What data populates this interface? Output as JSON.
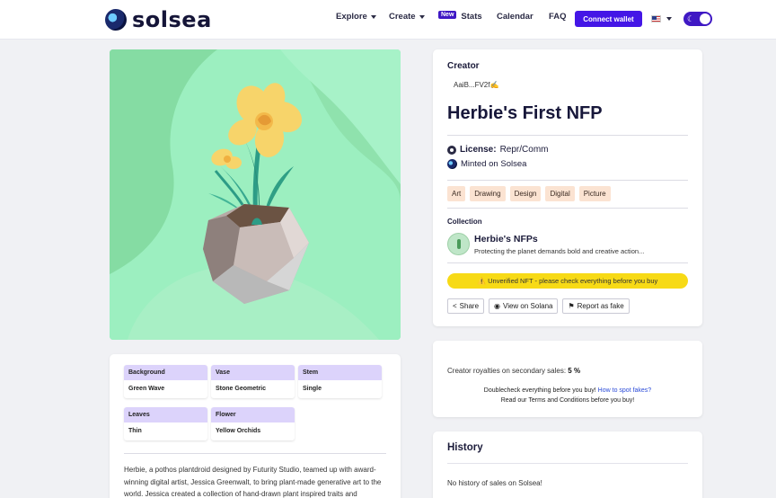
{
  "header": {
    "brand": "solsea",
    "nav": [
      {
        "label": "Explore",
        "dropdown": true
      },
      {
        "label": "Create",
        "dropdown": true
      },
      {
        "label": "Stats",
        "badge": "New"
      },
      {
        "label": "Calendar"
      },
      {
        "label": "FAQ"
      }
    ],
    "connect_label": "Connect wallet",
    "language": "us-flag-icon",
    "theme_toggle": "dark-mode"
  },
  "colors": {
    "accent": "#4416e6",
    "badge": "#3f18c4",
    "warning": "#f7da16",
    "tag_bg": "#fbe3d2",
    "attr_header": "#dcd3fb",
    "art_bg": "#7fdfa0"
  },
  "creator": {
    "label": "Creator",
    "address": "AaiB...FV2f✍"
  },
  "nft": {
    "title": "Herbie's First NFP",
    "license_label": "License:",
    "license_value": "Repr/Comm",
    "minted": "Minted on Solsea",
    "tags": [
      "Art",
      "Drawing",
      "Design",
      "Digital",
      "Picture"
    ]
  },
  "collection": {
    "label": "Collection",
    "name": "Herbie's NFPs",
    "description": "Protecting the planet demands bold and creative action..."
  },
  "warning": "⚠️ Unverified NFT - please check everything before you buy",
  "actions": [
    {
      "label": "Share",
      "icon": "share-icon"
    },
    {
      "label": "View on Solana",
      "icon": "globe-icon"
    },
    {
      "label": "Report as fake",
      "icon": "flag-icon"
    }
  ],
  "royalties": {
    "text": "Creator royalties on secondary sales:",
    "value": "5 %",
    "doublecheck": "Doublecheck everything before you buy!",
    "spot_link": "How to spot fakes?",
    "terms_prefix": "Read our",
    "terms_link": "Terms and Conditions",
    "terms_suffix": "before you buy!"
  },
  "history": {
    "title": "History",
    "empty": "No history of sales on Solsea!"
  },
  "attributes": [
    {
      "key": "Background",
      "value": "Green Wave"
    },
    {
      "key": "Vase",
      "value": "Stone Geometric"
    },
    {
      "key": "Stem",
      "value": "Single"
    },
    {
      "key": "Leaves",
      "value": "Thin"
    },
    {
      "key": "Flower",
      "value": "Yellow Orchids"
    }
  ],
  "description": "Herbie, a pothos plantdroid designed by Futurity Studio, teamed up with award-winning digital artist, Jessica Greenwalt, to bring plant-made generative art to the world. Jessica created a collection of hand-drawn plant inspired traits and"
}
